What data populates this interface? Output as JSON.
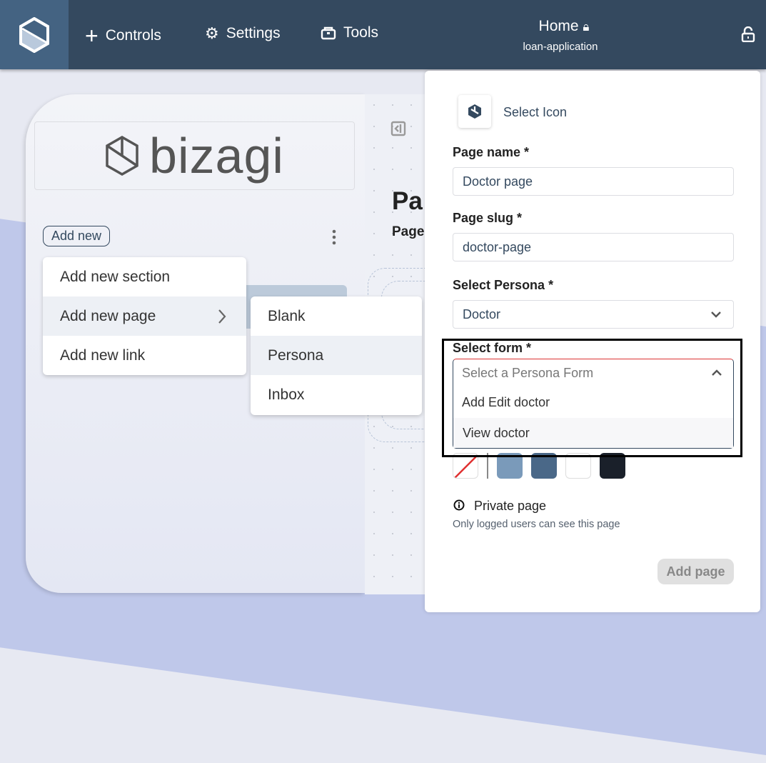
{
  "topbar": {
    "controls": "Controls",
    "settings": "Settings",
    "tools": "Tools",
    "title": "Home",
    "subtitle": "loan-application"
  },
  "sidebar": {
    "logo_text": "bizagi",
    "add_new": "Add new"
  },
  "canvas": {
    "heading": "Pa",
    "subheading": "Page"
  },
  "add_menu": {
    "items": [
      {
        "label": "Add new section"
      },
      {
        "label": "Add new page"
      },
      {
        "label": "Add new link"
      }
    ]
  },
  "page_submenu": {
    "items": [
      {
        "label": "Blank"
      },
      {
        "label": "Persona"
      },
      {
        "label": "Inbox"
      }
    ]
  },
  "form": {
    "select_icon": "Select Icon",
    "page_name_label": "Page name *",
    "page_name_value": "Doctor page",
    "page_slug_label": "Page slug *",
    "page_slug_value": "doctor-page",
    "persona_label": "Select Persona *",
    "persona_value": "Doctor",
    "form_label": "Select form *",
    "form_placeholder": "Select a Persona Form",
    "form_options": [
      {
        "label": "Add Edit doctor"
      },
      {
        "label": "View doctor"
      }
    ],
    "colors": [
      "none",
      "#7a9aba",
      "#4a6888",
      "#ffffff",
      "#1a202a"
    ],
    "private_label": "Private page",
    "private_desc": "Only logged users can see this page",
    "submit": "Add page"
  }
}
